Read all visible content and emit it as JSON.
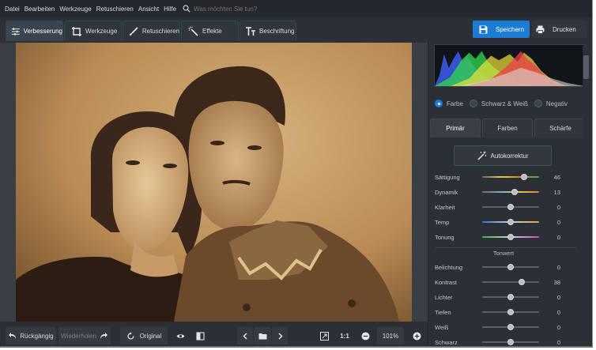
{
  "menu": {
    "items": [
      "Datei",
      "Bearbeiten",
      "Werkzeuge",
      "Retuschieren",
      "Ansicht",
      "Hilfe"
    ],
    "search_placeholder": "Was möchten Sie tun?"
  },
  "tabs": [
    {
      "label": "Verbesserung",
      "icon": "sliders-icon",
      "active": true
    },
    {
      "label": "Werkzeuge",
      "icon": "crop-icon",
      "active": false
    },
    {
      "label": "Retuschieren",
      "icon": "brush-icon",
      "active": false
    },
    {
      "label": "Effekte",
      "icon": "magic-wand-icon",
      "active": false
    },
    {
      "label": "Beschriftung",
      "icon": "text-icon",
      "active": false
    }
  ],
  "actions": {
    "save_label": "Speichern",
    "print_label": "Drucken"
  },
  "bottom": {
    "undo_label": "Rückgängig",
    "redo_label": "Wiederholen",
    "original_label": "Original",
    "ratio_label": "1:1",
    "zoom_value": "101%"
  },
  "color_modes": [
    {
      "label": "Farbe",
      "selected": true
    },
    {
      "label": "Schwarz & Weiß",
      "selected": false
    },
    {
      "label": "Negativ",
      "selected": false
    }
  ],
  "panel_tabs": [
    {
      "label": "Primär",
      "active": true
    },
    {
      "label": "Farben",
      "active": false
    },
    {
      "label": "Schärfe",
      "active": false
    }
  ],
  "auto_button_label": "Autokorrektur",
  "adjustments": [
    {
      "label": "Sättigung",
      "value": "46",
      "level": 0.73,
      "track": "saturation"
    },
    {
      "label": "Dynamik",
      "value": "13",
      "level": 0.57,
      "track": "vibrance"
    },
    {
      "label": "Klarheit",
      "value": "0",
      "level": 0.5,
      "track": "plain"
    },
    {
      "label": "Temp",
      "value": "0",
      "level": 0.5,
      "track": "temperature"
    },
    {
      "label": "Tonung",
      "value": "0",
      "level": 0.5,
      "track": "tint"
    }
  ],
  "tonwert_label": "Tonwert",
  "tone_adjustments": [
    {
      "label": "Belichtung",
      "value": "0",
      "level": 0.5
    },
    {
      "label": "Kontrast",
      "value": "38",
      "level": 0.69
    },
    {
      "label": "Lichter",
      "value": "0",
      "level": 0.5
    },
    {
      "label": "Tiefen",
      "value": "0",
      "level": 0.5
    },
    {
      "label": "Weiß",
      "value": "0",
      "level": 0.5
    },
    {
      "label": "Schwarz",
      "value": "0",
      "level": 0.5
    }
  ],
  "colors": {
    "accent": "#1c7bd3",
    "background": "#2b2f36"
  }
}
